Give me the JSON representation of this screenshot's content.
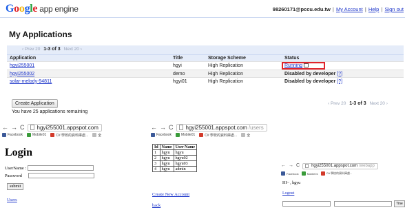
{
  "header": {
    "logo_google": "Google",
    "logo_suffix": "app engine",
    "user": "98260171@pccu.edu.tw",
    "separator": "|",
    "my_account": "My Account",
    "help": "Help",
    "sign_out": "Sign out"
  },
  "page_title": "My Applications",
  "pager": {
    "prev": "‹ Prev 20",
    "range": "1-3 of 3",
    "next": "Next 20 ›"
  },
  "table": {
    "headers": [
      "Application",
      "Title",
      "Storage Scheme",
      "Status"
    ],
    "rows": [
      {
        "app": "hgyi255001",
        "title": "hgyi",
        "storage": "High Replication",
        "status": "Running"
      },
      {
        "app": "hgyi255002",
        "title": "demo",
        "storage": "High Replication",
        "status": "Disabled by developer",
        "help": "[?]"
      },
      {
        "app": "solar-melody-94811",
        "title": "hgyi01",
        "storage": "High Replication",
        "status": "Disabled by developer",
        "help": "[?]"
      }
    ]
  },
  "create_button": "Create Application",
  "remaining": "You have 25 applications remaining",
  "windows": {
    "login": {
      "url_host": "hgyi255001.appspot.com",
      "url_path": "",
      "heading": "Login",
      "username_label": "UserName :",
      "password_label": "Password",
      "submit": "submit",
      "users_link": "Users"
    },
    "users": {
      "url_host": "hgyi255001.appspot.com",
      "url_path": "/users",
      "table_headers": [
        "Id",
        "Name",
        "User Name"
      ],
      "table_rows": [
        [
          "1",
          "hgyu",
          "hgyu"
        ],
        [
          "2",
          "hgyu",
          "hgyu02"
        ],
        [
          "3",
          "hgyu",
          "hgyu03"
        ],
        [
          "4",
          "hgyu",
          "admin"
        ]
      ],
      "create_link": "Create New Account",
      "back_link": "back"
    },
    "webapp": {
      "url_host": "hgyi255001.appspot.com",
      "url_path": "/webapp",
      "greeting": "HI~ , hgyu",
      "logout": "Logout",
      "button": "Tine"
    }
  },
  "bookmarks": {
    "facebook": "Facebook",
    "mobile": "Mobile01",
    "csharp": "C# 學校的資料庫處...",
    "extra": "全"
  }
}
